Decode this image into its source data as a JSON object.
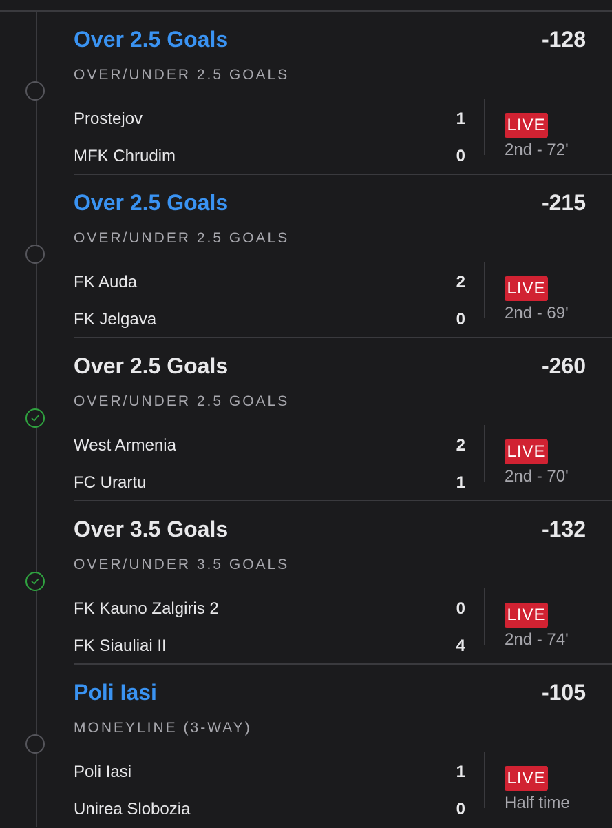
{
  "legs": [
    {
      "selection": "Over 2.5 Goals",
      "odds": "-128",
      "market": "OVER/UNDER 2.5 GOALS",
      "node_state": "pending",
      "home_team": "Prostejov",
      "home_score": "1",
      "away_team": "MFK Chrudim",
      "away_score": "0",
      "live_label": "LIVE",
      "status": "2nd - 72'"
    },
    {
      "selection": "Over 2.5 Goals",
      "odds": "-215",
      "market": "OVER/UNDER 2.5 GOALS",
      "node_state": "pending",
      "home_team": "FK Auda",
      "home_score": "2",
      "away_team": "FK Jelgava",
      "away_score": "0",
      "live_label": "LIVE",
      "status": "2nd - 69'"
    },
    {
      "selection": "Over 2.5 Goals",
      "odds": "-260",
      "market": "OVER/UNDER 2.5 GOALS",
      "node_state": "won",
      "home_team": "West Armenia",
      "home_score": "2",
      "away_team": "FC Urartu",
      "away_score": "1",
      "live_label": "LIVE",
      "status": "2nd - 70'"
    },
    {
      "selection": "Over 3.5 Goals",
      "odds": "-132",
      "market": "OVER/UNDER 3.5 GOALS",
      "node_state": "won",
      "home_team": "FK Kauno Zalgiris 2",
      "home_score": "0",
      "away_team": "FK Siauliai II",
      "away_score": "4",
      "live_label": "LIVE",
      "status": "2nd - 74'"
    },
    {
      "selection": "Poli Iasi",
      "odds": "-105",
      "market": "MONEYLINE (3-WAY)",
      "node_state": "pending",
      "home_team": "Poli Iasi",
      "home_score": "1",
      "away_team": "Unirea Slobozia",
      "away_score": "0",
      "live_label": "LIVE",
      "status": "Half time"
    }
  ],
  "colors": {
    "background": "#1b1b1d",
    "pending_title": "#3a93f2",
    "won_check": "#2fa23f",
    "live_badge": "#d12232",
    "muted_text": "#a7a7ad"
  },
  "icons": {
    "pending_node": "empty-circle-icon",
    "won_node": "check-circle-icon"
  }
}
